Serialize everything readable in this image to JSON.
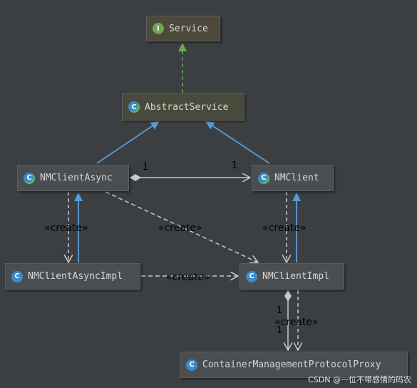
{
  "nodes": {
    "service": {
      "name": "Service",
      "kind": "interface",
      "icon": "interface-icon"
    },
    "abstract_service": {
      "name": "AbstractService",
      "kind": "abstract-class",
      "icon": "abstract-class-icon"
    },
    "nm_client_async": {
      "name": "NMClientAsync",
      "kind": "abstract-class",
      "icon": "abstract-class-icon"
    },
    "nm_client": {
      "name": "NMClient",
      "kind": "abstract-class",
      "icon": "abstract-class-icon"
    },
    "nm_client_async_impl": {
      "name": "NMClientAsyncImpl",
      "kind": "class",
      "icon": "class-icon"
    },
    "nm_client_impl": {
      "name": "NMClientImpl",
      "kind": "class",
      "icon": "class-icon"
    },
    "container_proxy": {
      "name": "ContainerManagementProtocolProxy",
      "kind": "class",
      "icon": "class-icon"
    }
  },
  "badges": {
    "interface": "I",
    "class": "C"
  },
  "edges": {
    "create_label": "«create»",
    "mult_one": "1"
  },
  "colors": {
    "background": "#3c3f41",
    "implements": "#6aa84f",
    "extends": "#5b9bd5",
    "dependency": "#c8c8c8",
    "association": "#c8c8c8"
  },
  "watermark": "CSDN @一位不带感情的码农"
}
